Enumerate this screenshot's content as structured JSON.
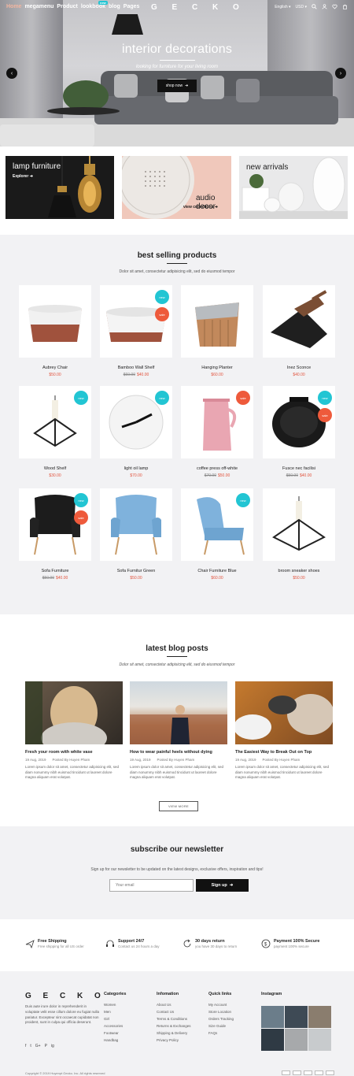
{
  "header": {
    "menu": [
      "Home",
      "megamenu",
      "Product",
      "lookbook",
      "blog",
      "Pages"
    ],
    "badge": "new",
    "logo": "G E C K O",
    "language": "English",
    "currency": "USD"
  },
  "hero": {
    "title": "interior decorations",
    "subtitle": "looking for furniture for your living room",
    "button": "shop now"
  },
  "banners": [
    {
      "title": "lamp furniture",
      "link": "Explorer"
    },
    {
      "title": "audio decor",
      "link": "view collections"
    },
    {
      "title": "new arrivals",
      "link": ""
    }
  ],
  "best_selling": {
    "title": "best selling products",
    "subtitle": "Dolor sit amet, consectetur adipisicing elit, sed do eiusmod tempor",
    "products": [
      {
        "name": "Aubrey Chair",
        "price": "$50.00",
        "old": "",
        "tags": []
      },
      {
        "name": "Bamboo Wall Shelf",
        "price": "$40.00",
        "old": "$60.00",
        "tags": [
          "new",
          "sale"
        ]
      },
      {
        "name": "Hanging Planter",
        "price": "$60.00",
        "old": "",
        "tags": []
      },
      {
        "name": "Inez Sconce",
        "price": "$40.00",
        "old": "",
        "tags": []
      },
      {
        "name": "Wood Shelf",
        "price": "$30.00",
        "old": "",
        "tags": [
          "new"
        ]
      },
      {
        "name": "light oil lamp",
        "price": "$70.00",
        "old": "",
        "tags": [
          "new"
        ]
      },
      {
        "name": "coffee press off-white",
        "price": "$50.00",
        "old": "$70.00",
        "tags": [
          "sale"
        ]
      },
      {
        "name": "Fusce nec facilisi",
        "price": "$40.00",
        "old": "$50.00",
        "tags": [
          "new",
          "sale"
        ]
      },
      {
        "name": "Sofa Furniture",
        "price": "$40.00",
        "old": "$50.00",
        "tags": [
          "new",
          "sale"
        ]
      },
      {
        "name": "Sofa Furnitur Green",
        "price": "$50.00",
        "old": "",
        "tags": []
      },
      {
        "name": "Chair Furniture Blue",
        "price": "$60.00",
        "old": "",
        "tags": [
          "new"
        ]
      },
      {
        "name": "broom sneaker shoes",
        "price": "$50.00",
        "old": "",
        "tags": []
      }
    ]
  },
  "blog": {
    "title": "latest blog posts",
    "subtitle": "Dolor sit amet, consectetur adipisicing elit, sed do eiusmod tempor",
    "posts": [
      {
        "title": "Fresh your room with white vase",
        "date": "19 Aug, 2019",
        "author": "Posted By Huyen Pham",
        "excerpt": "Lorem ipsum dolor sit amet, consectetur adipisicing elit, sed diam nonummy nibh euismod tincidunt ut laoreet dolore magna aliquam erat volutpat."
      },
      {
        "title": "How to wear painful heels without dying",
        "date": "19 Aug, 2019",
        "author": "Posted By Huyen Pham",
        "excerpt": "Lorem ipsum dolor sit amet, consectetur adipisicing elit, sed diam nonummy nibh euismod tincidunt ut laoreet dolore magna aliquam erat volutpat."
      },
      {
        "title": "The Easiest Way to Break Out on Top",
        "date": "19 Aug, 2019",
        "author": "Posted By Huyen Pham",
        "excerpt": "Lorem ipsum dolor sit amet, consectetur adipisicing elit, sed diam nonummy nibh euismod tincidunt ut laoreet dolore magna aliquam erat volutpat."
      }
    ],
    "view_more": "VIEW MORE"
  },
  "newsletter": {
    "title": "subscribe our newsletter",
    "subtitle": "Sign up for our newsletter to be updated on the latest designs, exclusive offers, inspiration and tips!",
    "placeholder": "Your email",
    "button": "Sign up"
  },
  "features": [
    {
      "title": "Free Shipping",
      "sub": "Free shipping for all US order"
    },
    {
      "title": "Support 24/7",
      "sub": "Contact us 24 hours a day"
    },
    {
      "title": "30 days return",
      "sub": "you have 30 days to return"
    },
    {
      "title": "Payment 100% Secure",
      "sub": "payment 100% secure"
    }
  ],
  "footer": {
    "logo": "G E C K O",
    "about": "Duis aute irure dolor in reprehenderit in voluptate velit esse cillum dolore eu fugiat nulla pariatur. Excepteur sint occaecat cupidatat non proident, sunt in culpa qui officia deserunt.",
    "social": [
      "f",
      "t",
      "G+",
      "P",
      "ig"
    ],
    "columns": [
      {
        "title": "Categories",
        "items": [
          "Women",
          "Men",
          "Girl",
          "Accessories",
          "Footwear",
          "Handbag"
        ]
      },
      {
        "title": "Infomation",
        "items": [
          "About Us",
          "Contact Us",
          "Terms & Conditions",
          "Returns & Exchanges",
          "Shipping & Delivery",
          "Privacy Policy"
        ]
      },
      {
        "title": "Quick links",
        "items": [
          "My Account",
          "Store Location",
          "Orders Tracking",
          "Size Guide",
          "FAQs"
        ]
      }
    ],
    "instagram_title": "Instagram",
    "copyright": "Copyright © 2019 Huyenpt Gecko. Inc. All rights reserved"
  }
}
